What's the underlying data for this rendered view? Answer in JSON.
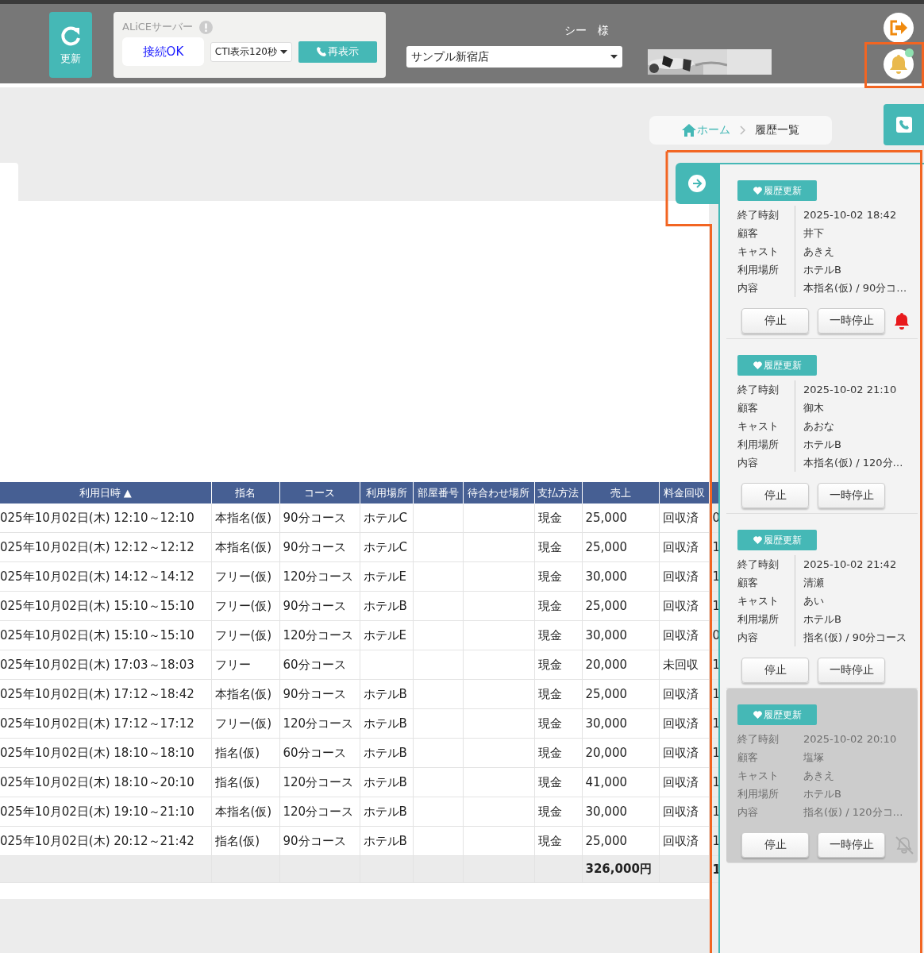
{
  "header": {
    "refresh_button": "更新",
    "server": {
      "label": "ALiCEサーバー",
      "status": "接続OK",
      "cti_select": "CTI表示120秒",
      "redisplay_button": "再表示"
    },
    "user": "シー　様",
    "store_select": "サンプル新宿店",
    "notification_dot": true
  },
  "breadcrumb": {
    "home": "ホーム",
    "current": "履歴一覧"
  },
  "table": {
    "columns": [
      "利用日時 ▲",
      "指名",
      "コース",
      "利用場所",
      "部屋番号",
      "待合わせ場所",
      "支払方法",
      "売上",
      "料金回収",
      ""
    ],
    "rows": [
      [
        "025年10月02日(木) 12:10～12:10",
        "本指名(仮)",
        "90分コース",
        "ホテルC",
        "",
        "",
        "現金",
        "25,000",
        "回収済",
        "0"
      ],
      [
        "025年10月02日(木) 12:12～12:12",
        "本指名(仮)",
        "90分コース",
        "ホテルC",
        "",
        "",
        "現金",
        "25,000",
        "回収済",
        "1"
      ],
      [
        "025年10月02日(木) 14:12～14:12",
        "フリー(仮)",
        "120分コース",
        "ホテルE",
        "",
        "",
        "現金",
        "30,000",
        "回収済",
        "1"
      ],
      [
        "025年10月02日(木) 15:10～15:10",
        "フリー(仮)",
        "90分コース",
        "ホテルB",
        "",
        "",
        "現金",
        "25,000",
        "回収済",
        "1"
      ],
      [
        "025年10月02日(木) 15:10～15:10",
        "フリー(仮)",
        "120分コース",
        "ホテルE",
        "",
        "",
        "現金",
        "30,000",
        "回収済",
        "0"
      ],
      [
        "025年10月02日(木) 17:03～18:03",
        "フリー",
        "60分コース",
        "",
        "",
        "",
        "現金",
        "20,000",
        "未回収",
        "1"
      ],
      [
        "025年10月02日(木) 17:12～18:42",
        "本指名(仮)",
        "90分コース",
        "ホテルB",
        "",
        "",
        "現金",
        "25,000",
        "回収済",
        "1"
      ],
      [
        "025年10月02日(木) 17:12～17:12",
        "フリー(仮)",
        "120分コース",
        "ホテルB",
        "",
        "",
        "現金",
        "30,000",
        "回収済",
        "1"
      ],
      [
        "025年10月02日(木) 18:10～18:10",
        "指名(仮)",
        "60分コース",
        "ホテルB",
        "",
        "",
        "現金",
        "20,000",
        "回収済",
        "1"
      ],
      [
        "025年10月02日(木) 18:10～20:10",
        "指名(仮)",
        "120分コース",
        "ホテルB",
        "",
        "",
        "現金",
        "41,000",
        "回収済",
        "1"
      ],
      [
        "025年10月02日(木) 19:10～21:10",
        "本指名(仮)",
        "120分コース",
        "ホテルB",
        "",
        "",
        "現金",
        "30,000",
        "回収済",
        "1"
      ],
      [
        "025年10月02日(木) 20:12～21:42",
        "指名(仮)",
        "90分コース",
        "ホテルB",
        "",
        "",
        "現金",
        "25,000",
        "回収済",
        "1"
      ]
    ],
    "total_row": {
      "sales": "326,000円",
      "column_10": "1"
    }
  },
  "notifications": [
    {
      "badge": "履歴更新",
      "alarm": true,
      "muted": false,
      "fields": [
        {
          "label": "終了時刻",
          "value": "2025-10-02 18:42"
        },
        {
          "label": "顧客",
          "value": "井下"
        },
        {
          "label": "キャスト",
          "value": "あきえ"
        },
        {
          "label": "利用場所",
          "value": "ホテルB"
        },
        {
          "label": "内容",
          "value": "本指名(仮) / 90分コ…"
        }
      ],
      "buttons": [
        "停止",
        "一時停止"
      ]
    },
    {
      "badge": "履歴更新",
      "alarm": false,
      "muted": false,
      "fields": [
        {
          "label": "終了時刻",
          "value": "2025-10-02 21:10"
        },
        {
          "label": "顧客",
          "value": "御木"
        },
        {
          "label": "キャスト",
          "value": "あおな"
        },
        {
          "label": "利用場所",
          "value": "ホテルB"
        },
        {
          "label": "内容",
          "value": "本指名(仮) / 120分…"
        }
      ],
      "buttons": [
        "停止",
        "一時停止"
      ]
    },
    {
      "badge": "履歴更新",
      "alarm": false,
      "muted": false,
      "fields": [
        {
          "label": "終了時刻",
          "value": "2025-10-02 21:42"
        },
        {
          "label": "顧客",
          "value": "清瀬"
        },
        {
          "label": "キャスト",
          "value": "あい"
        },
        {
          "label": "利用場所",
          "value": "ホテルB"
        },
        {
          "label": "内容",
          "value": "指名(仮) / 90分コース"
        }
      ],
      "buttons": [
        "停止",
        "一時停止"
      ]
    },
    {
      "badge": "履歴更新",
      "alarm": false,
      "muted": true,
      "fields": [
        {
          "label": "終了時刻",
          "value": "2025-10-02 20:10"
        },
        {
          "label": "顧客",
          "value": "塩塚"
        },
        {
          "label": "キャスト",
          "value": "あきえ"
        },
        {
          "label": "利用場所",
          "value": "ホテルB"
        },
        {
          "label": "内容",
          "value": "指名(仮) / 120分コ…"
        }
      ],
      "buttons": [
        "停止",
        "一時停止"
      ]
    }
  ]
}
